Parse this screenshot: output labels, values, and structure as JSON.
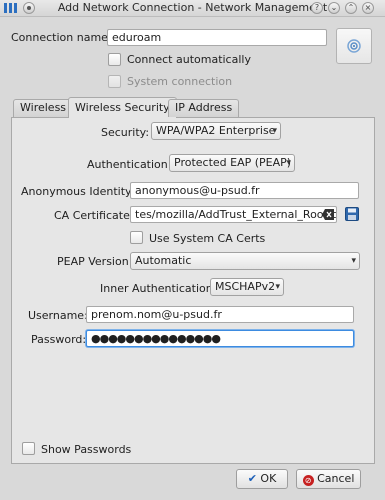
{
  "window": {
    "title": "Add Network Connection - Network Management",
    "help_glyph": "?",
    "minimize_glyph": "⌄",
    "maximize_glyph": "⌃",
    "close_glyph": "×"
  },
  "connection_name": {
    "label": "Connection name:",
    "value": "eduroam"
  },
  "options": {
    "connect_automatically": "Connect automatically",
    "system_connection": "System connection"
  },
  "tabs": [
    "Wireless",
    "Wireless Security",
    "IP Address"
  ],
  "security": {
    "label": "Security:",
    "value": "WPA/WPA2 Enterprise"
  },
  "authentication": {
    "label": "Authentication:",
    "value": "Protected EAP (PEAP)"
  },
  "anonymous_identity": {
    "label": "Anonymous Identity:",
    "value": "anonymous@u-psud.fr"
  },
  "ca_certificate": {
    "label": "CA Certificate:",
    "value": "tes/mozilla/AddTrust_External_Root.crt",
    "use_system": "Use System CA Certs"
  },
  "peap_version": {
    "label": "PEAP Version:",
    "value": "Automatic"
  },
  "inner_authentication": {
    "label": "Inner Authentication:",
    "value": "MSCHAPv2"
  },
  "username": {
    "label": "Username:",
    "value": "prenom.nom@u-psud.fr"
  },
  "password": {
    "label": "Password:",
    "value": "●●●●●●●●●●●●●●●"
  },
  "show_passwords": "Show Passwords",
  "buttons": {
    "ok": "OK",
    "cancel": "Cancel"
  },
  "colors": {
    "ok_check": "#1c5fb8",
    "cancel_icon": "#c62020",
    "window_bg": "#d9d9d9",
    "focus": "#3d8be0"
  }
}
